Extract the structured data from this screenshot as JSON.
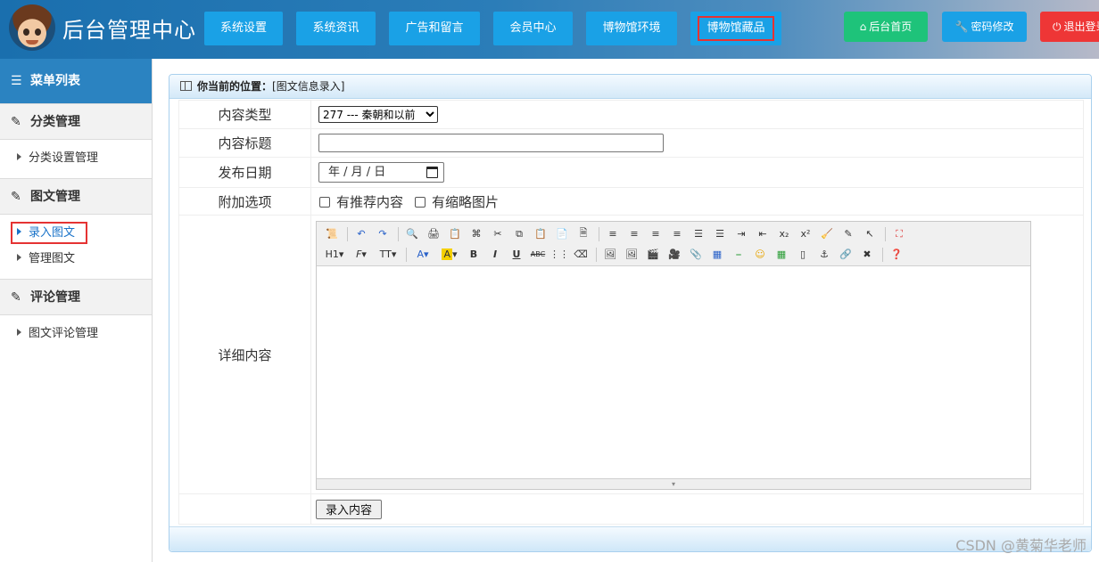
{
  "app": {
    "title": "后台管理中心"
  },
  "topnav": [
    "系统设置",
    "系统资讯",
    "广告和留言",
    "会员中心",
    "博物馆环境",
    "博物馆藏品"
  ],
  "actions": {
    "home": "后台首页",
    "password": "密码修改",
    "logout": "退出登录"
  },
  "colors": {
    "home": "#1ec37a",
    "password": "#1aa1e6",
    "logout": "#ee3636",
    "nav": "#1aa1e6",
    "sidebar_head": "#2b83c1",
    "highlight": "#e53333"
  },
  "sidebar": {
    "title": "菜单列表",
    "groups": [
      {
        "label": "分类管理",
        "items": [
          "分类设置管理"
        ]
      },
      {
        "label": "图文管理",
        "items": [
          "录入图文",
          "管理图文"
        ]
      },
      {
        "label": "评论管理",
        "items": [
          "图文评论管理"
        ]
      }
    ]
  },
  "breadcrumb": {
    "label": "你当前的位置：",
    "value": "[图文信息录入]"
  },
  "form": {
    "type_label": "内容类型",
    "type_value": "277 --- 秦朝和以前",
    "title_label": "内容标题",
    "title_value": "",
    "date_label": "发布日期",
    "date_placeholder": "年 / 月 / 日",
    "options_label": "附加选项",
    "option_recommend": "有推荐内容",
    "option_thumb": "有缩略图片",
    "detail_label": "详细内容",
    "submit": "录入内容"
  },
  "watermark": "CSDN @黄菊华老师"
}
